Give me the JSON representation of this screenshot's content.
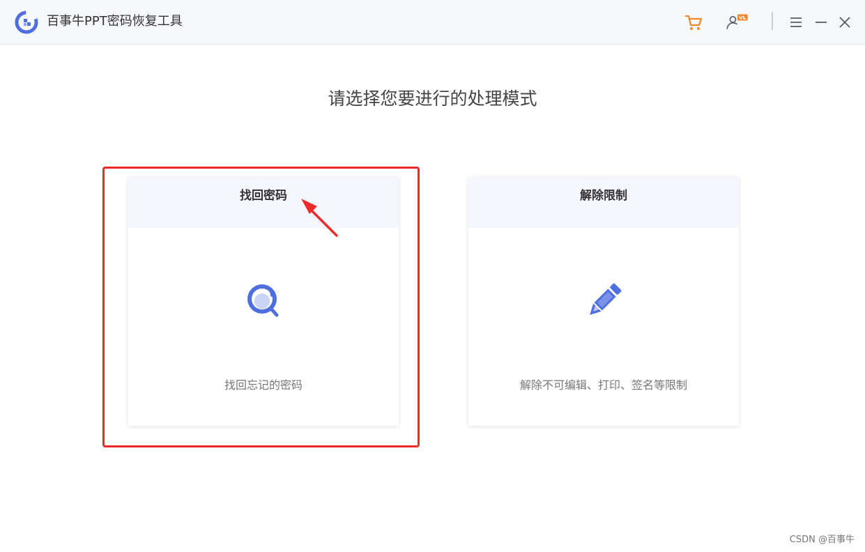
{
  "app": {
    "title": "百事牛PPT密码恢复工具",
    "accent_color": "#4f6ee0",
    "cart_color": "#f5872b"
  },
  "titlebar": {
    "icons": [
      "logo-icon",
      "cart-icon",
      "user-vip-icon",
      "menu-icon",
      "minimize-icon",
      "close-icon"
    ]
  },
  "main": {
    "heading": "请选择您要进行的处理模式",
    "cards": [
      {
        "title": "找回密码",
        "description": "找回忘记的密码",
        "icon": "magnifier-icon"
      },
      {
        "title": "解除限制",
        "description": "解除不可编辑、打印、签名等限制",
        "icon": "pencil-icon"
      }
    ]
  },
  "annotation": {
    "highlight_color": "#ee2b2b"
  },
  "watermark": "CSDN @百事牛"
}
